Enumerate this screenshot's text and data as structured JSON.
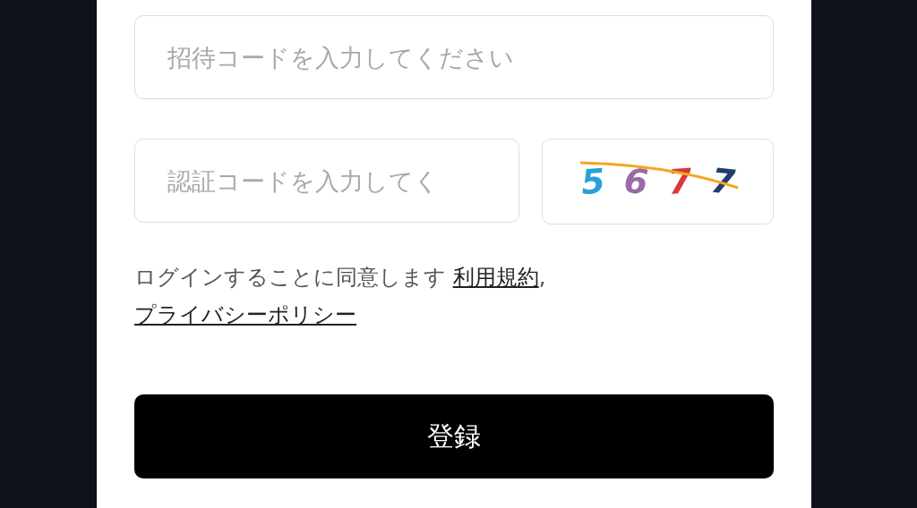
{
  "invite_field": {
    "placeholder": "招待コードを入力してください"
  },
  "verification_field": {
    "placeholder": "認証コードを入力してく"
  },
  "captcha": {
    "digits": [
      {
        "text": "5",
        "color": "#2aa0d8"
      },
      {
        "text": "6",
        "color": "#9a6aa8"
      },
      {
        "text": "7",
        "color": "#d8383a"
      },
      {
        "text": "7",
        "color": "#1e3f6e"
      }
    ]
  },
  "consent": {
    "text": "ログインすることに同意します",
    "terms_link": "利用規約",
    "separator": ",",
    "privacy_link": "プライバシーポリシー"
  },
  "submit_button": "登録"
}
